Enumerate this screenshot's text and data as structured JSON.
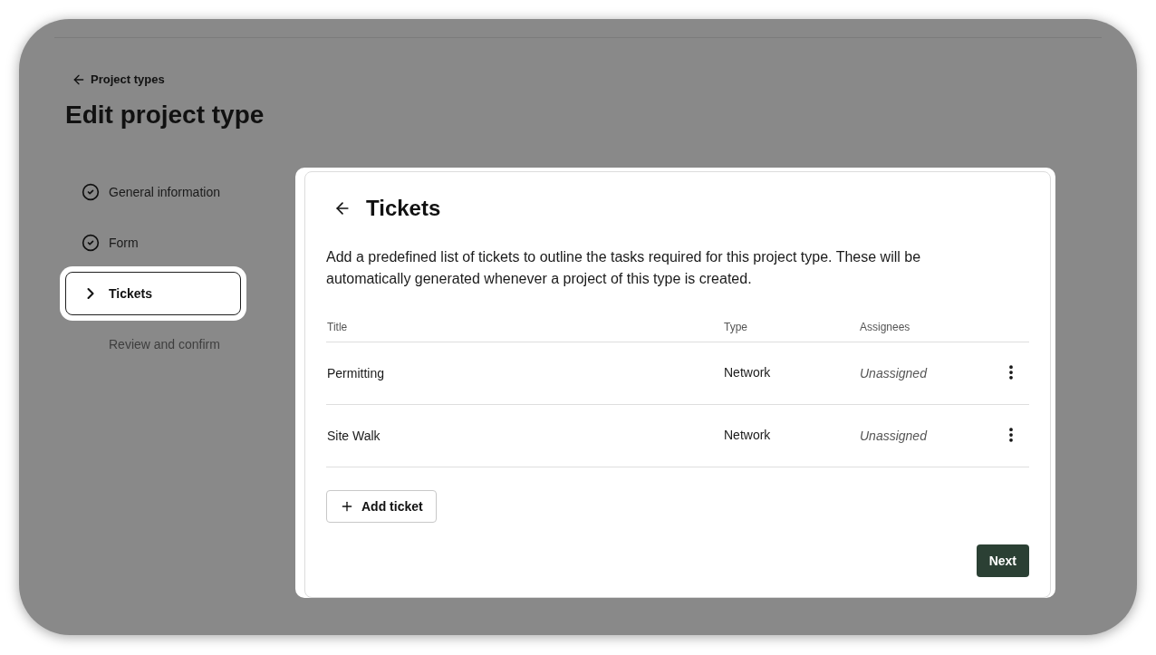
{
  "back_link": {
    "label": "Project types"
  },
  "title": "Edit project type",
  "steps": [
    {
      "label": "General information",
      "completed": true,
      "selected": false
    },
    {
      "label": "Form",
      "completed": true,
      "selected": false
    },
    {
      "label": "Tickets",
      "completed": false,
      "selected": true
    },
    {
      "label": "Review and confirm",
      "completed": false,
      "selected": false
    }
  ],
  "panel": {
    "title": "Tickets",
    "description": "Add a predefined list of tickets to outline the tasks required for this project type. These will be automatically generated whenever a project of this type is created.",
    "table": {
      "columns": [
        "Title",
        "Type",
        "Assignees"
      ],
      "rows": [
        {
          "title": "Permitting",
          "type": "Network",
          "assignees": "Unassigned"
        },
        {
          "title": "Site Walk",
          "type": "Network",
          "assignees": "Unassigned"
        }
      ]
    },
    "add_button": "Add ticket",
    "next_button": "Next"
  }
}
